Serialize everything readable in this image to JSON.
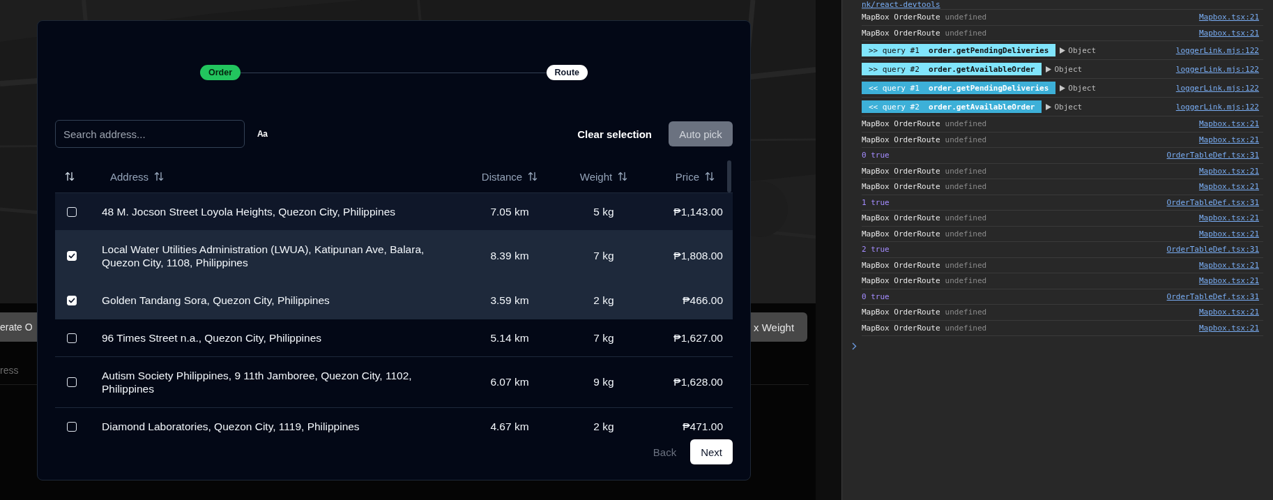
{
  "backdrop": {
    "left_button": "erate O",
    "right_button": "x Weight",
    "section_label": "ress"
  },
  "modal": {
    "steps": [
      {
        "label": "Order",
        "active": true
      },
      {
        "label": "Route",
        "active": false
      }
    ],
    "search": {
      "placeholder": "Search address..."
    },
    "case_toggle": "Aa",
    "clear_selection": "Clear selection",
    "auto_pick": {
      "label": "Auto pick",
      "disabled": true
    },
    "table": {
      "columns": [
        "Address",
        "Distance",
        "Weight",
        "Price"
      ],
      "rows": [
        {
          "address": "48 M. Jocson Street Loyola Heights, Quezon City, Philippines",
          "distance": "7.05 km",
          "weight": "5 kg",
          "price": "₱1,143.00",
          "checked": false,
          "hovered": true
        },
        {
          "address": "Local Water Utilities Administration (LWUA), Katipunan Ave, Balara, Quezon City, 1108, Philippines",
          "distance": "8.39 km",
          "weight": "7 kg",
          "price": "₱1,808.00",
          "checked": true,
          "hovered": false
        },
        {
          "address": "Golden Tandang Sora, Quezon City, Philippines",
          "distance": "3.59 km",
          "weight": "2 kg",
          "price": "₱466.00",
          "checked": true,
          "hovered": false
        },
        {
          "address": "96 Times Street n.a., Quezon City, Philippines",
          "distance": "5.14 km",
          "weight": "7 kg",
          "price": "₱1,627.00",
          "checked": false,
          "hovered": false
        },
        {
          "address": "Autism Society Philippines, 9 11th Jamboree, Quezon City, 1102, Philippines",
          "distance": "6.07 km",
          "weight": "9 kg",
          "price": "₱1,628.00",
          "checked": false,
          "hovered": false
        },
        {
          "address": "Diamond Laboratories, Quezon City, 1119, Philippines",
          "distance": "4.67 km",
          "weight": "2 kg",
          "price": "₱471.00",
          "checked": false,
          "hovered": false
        }
      ]
    },
    "back": {
      "label": "Back",
      "disabled": true
    },
    "next": {
      "label": "Next"
    }
  },
  "console": {
    "entries": [
      {
        "kind": "link",
        "text": "nk/react-devtools"
      },
      {
        "kind": "log",
        "text": "MapBox OrderRoute",
        "value": "undefined",
        "source": "Mapbox.tsx:21"
      },
      {
        "kind": "log",
        "text": "MapBox OrderRoute",
        "value": "undefined",
        "source": "Mapbox.tsx:21"
      },
      {
        "kind": "query",
        "returned": false,
        "badge": ">> query #1",
        "procedure": "order.getPendingDeliveries",
        "color": "#80e5fc",
        "object": "Object",
        "source": "loggerLink.mjs:122"
      },
      {
        "kind": "query",
        "returned": false,
        "badge": ">> query #2",
        "procedure": "order.getAvailableOrder",
        "color": "#80e5fc",
        "object": "Object",
        "source": "loggerLink.mjs:122"
      },
      {
        "kind": "query",
        "returned": true,
        "badge": "<< query #1",
        "procedure": "order.getPendingDeliveries",
        "color": "#3db0d8",
        "object": "Object",
        "source": "loggerLink.mjs:122"
      },
      {
        "kind": "query",
        "returned": true,
        "badge": "<< query #2",
        "procedure": "order.getAvailableOrder",
        "color": "#3db0d8",
        "object": "Object",
        "source": "loggerLink.mjs:122"
      },
      {
        "kind": "log",
        "text": "MapBox OrderRoute",
        "value": "undefined",
        "source": "Mapbox.tsx:21"
      },
      {
        "kind": "log",
        "text": "MapBox OrderRoute",
        "value": "undefined",
        "source": "Mapbox.tsx:21"
      },
      {
        "kind": "value",
        "text": "0 true",
        "source": "OrderTableDef.tsx:31"
      },
      {
        "kind": "log",
        "text": "MapBox OrderRoute",
        "value": "undefined",
        "source": "Mapbox.tsx:21"
      },
      {
        "kind": "log",
        "text": "MapBox OrderRoute",
        "value": "undefined",
        "source": "Mapbox.tsx:21"
      },
      {
        "kind": "value",
        "text": "1 true",
        "source": "OrderTableDef.tsx:31"
      },
      {
        "kind": "log",
        "text": "MapBox OrderRoute",
        "value": "undefined",
        "source": "Mapbox.tsx:21"
      },
      {
        "kind": "log",
        "text": "MapBox OrderRoute",
        "value": "undefined",
        "source": "Mapbox.tsx:21"
      },
      {
        "kind": "value",
        "text": "2 true",
        "source": "OrderTableDef.tsx:31"
      },
      {
        "kind": "log",
        "text": "MapBox OrderRoute",
        "value": "undefined",
        "source": "Mapbox.tsx:21"
      },
      {
        "kind": "log",
        "text": "MapBox OrderRoute",
        "value": "undefined",
        "source": "Mapbox.tsx:21"
      },
      {
        "kind": "value",
        "text": "0 true",
        "source": "OrderTableDef.tsx:31"
      },
      {
        "kind": "log",
        "text": "MapBox OrderRoute",
        "value": "undefined",
        "source": "Mapbox.tsx:21"
      },
      {
        "kind": "log",
        "text": "MapBox OrderRoute",
        "value": "undefined",
        "source": "Mapbox.tsx:21"
      }
    ]
  }
}
